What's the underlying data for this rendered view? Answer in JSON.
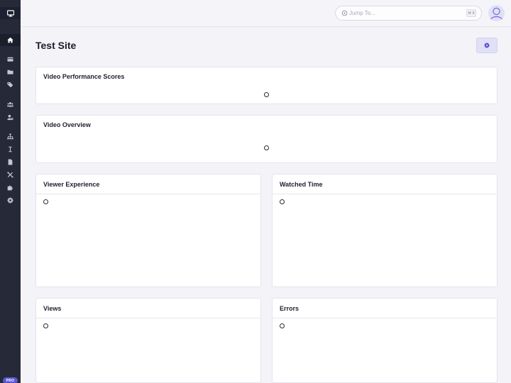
{
  "header": {
    "search": {
      "placeholder": "Jump To...",
      "shortcut": "⌘ K"
    }
  },
  "page": {
    "title": "Test Site"
  },
  "cards": {
    "video_performance": {
      "title": "Video Performance Scores"
    },
    "video_overview": {
      "title": "Video Overview"
    },
    "viewer_experience": {
      "title": "Viewer Experience"
    },
    "watched_time": {
      "title": "Watched Time"
    },
    "views": {
      "title": "Views"
    },
    "errors": {
      "title": "Errors"
    }
  },
  "sidebar": {
    "badge": "PRO",
    "icons": [
      "monitor-icon",
      "home-icon",
      "card-icon",
      "folder-icon",
      "tags-icon",
      "users-icon",
      "user-settings-icon",
      "sitemap-icon",
      "text-cursor-icon",
      "file-icon",
      "tools-icon",
      "puzzle-icon",
      "gear-icon"
    ]
  },
  "colors": {
    "sidebar": "#262938",
    "accent": "#5b57d1",
    "accent_light": "#e1e0f6",
    "background": "#f3f3f8"
  }
}
